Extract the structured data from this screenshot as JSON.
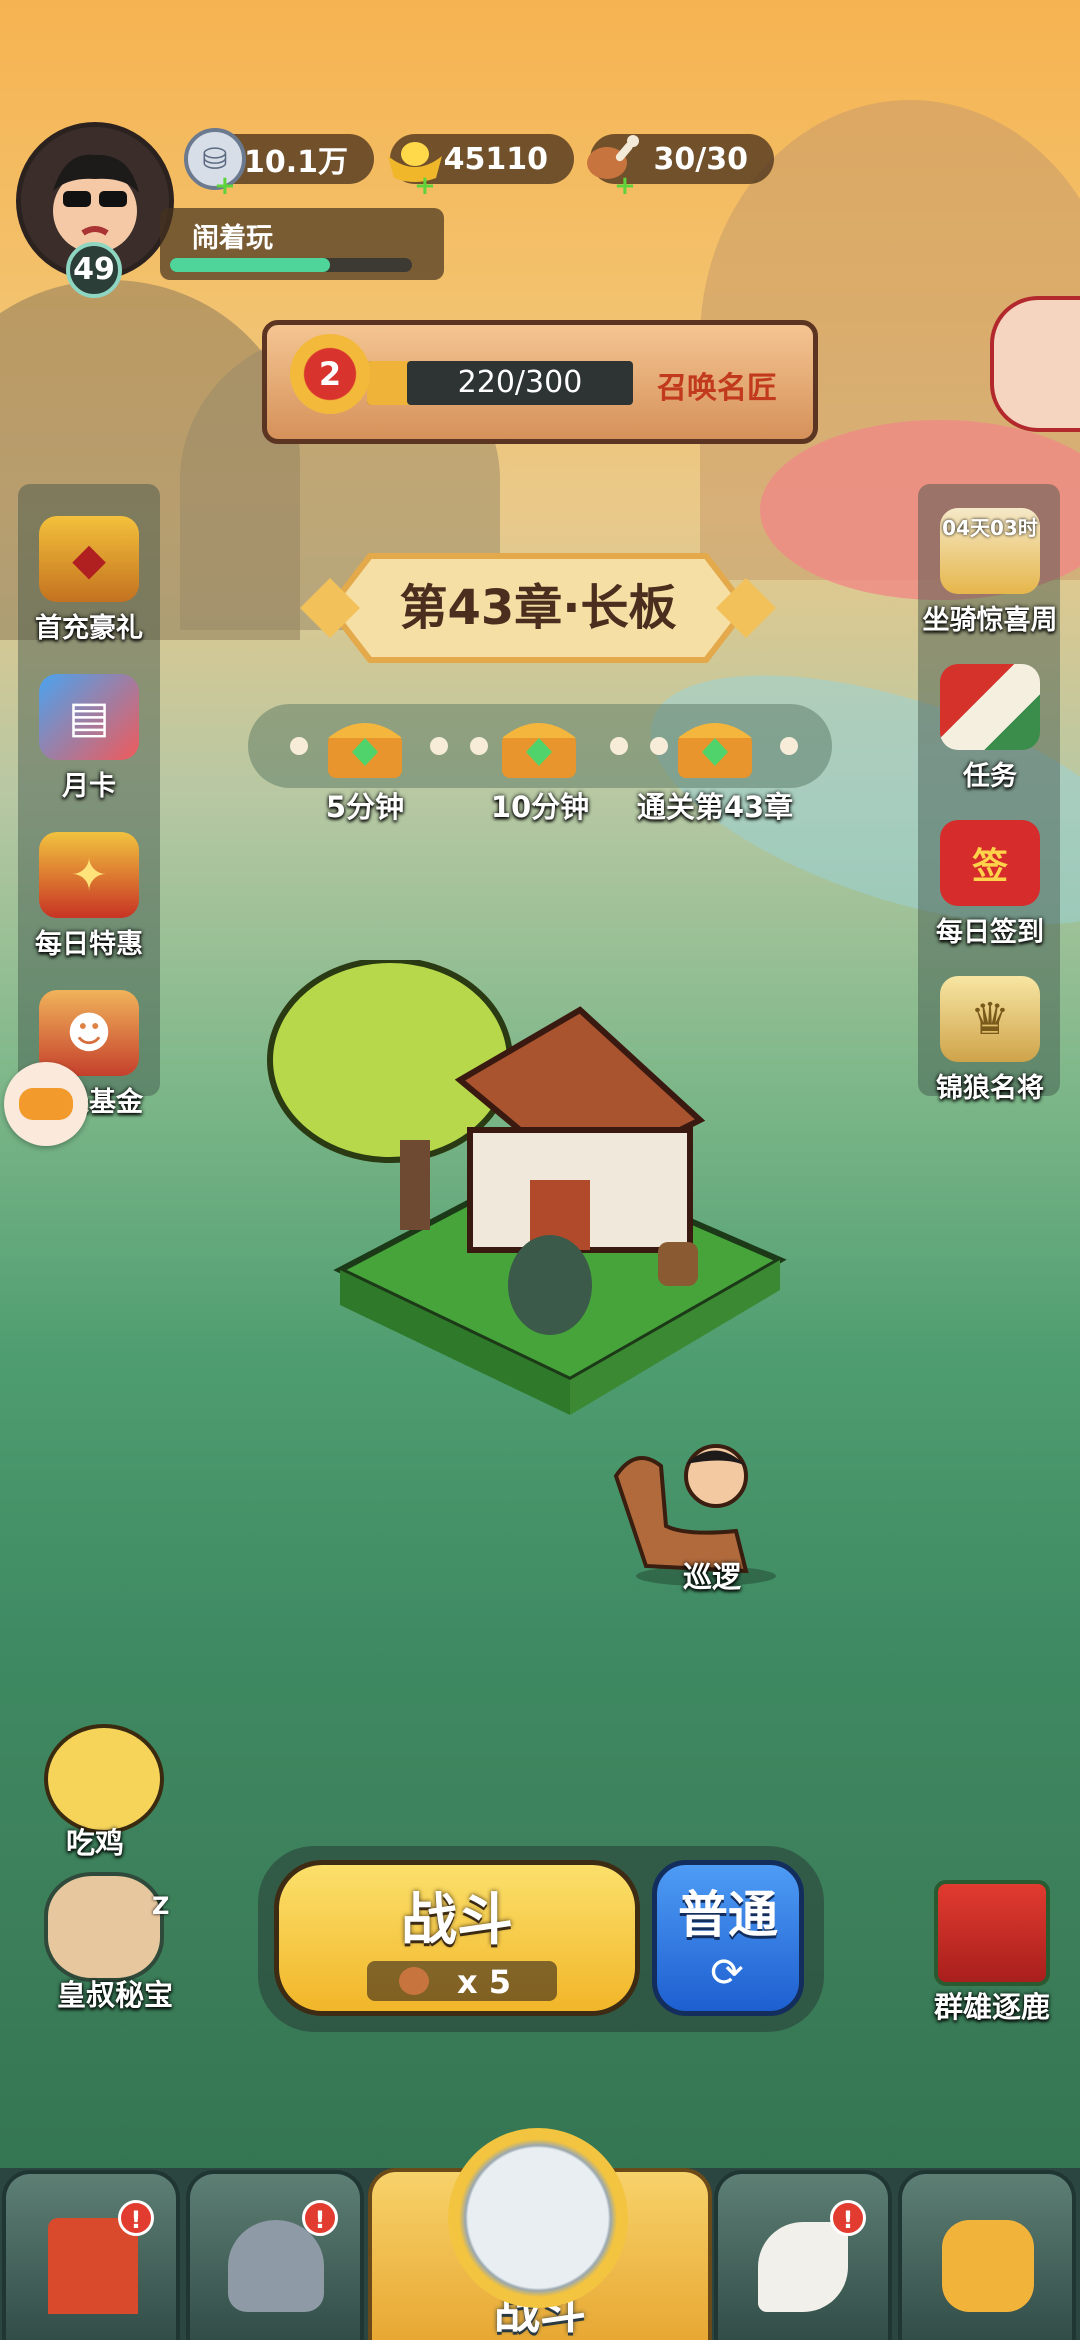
{
  "player": {
    "name": "闹着玩",
    "level": "49",
    "exp_progress": 0.66
  },
  "currencies": [
    {
      "icon": "silver-coin-icon",
      "value": "10.1万"
    },
    {
      "icon": "gold-ingot-icon",
      "value": "45110"
    },
    {
      "icon": "meat-stamina-icon",
      "value": "30/30"
    }
  ],
  "summon": {
    "rank": "2",
    "progress_text": "220/300",
    "progress": 0.733,
    "action_label": "召唤名匠"
  },
  "chapter": {
    "title": "第43章·长板"
  },
  "rewards": [
    {
      "label": "5分钟"
    },
    {
      "label": "10分钟"
    },
    {
      "label": "通关第43章"
    }
  ],
  "left_menu": [
    {
      "label": "首充豪礼",
      "icon": "treasure-chest-icon"
    },
    {
      "label": "月卡",
      "icon": "month-card-icon"
    },
    {
      "label": "每日特惠",
      "icon": "gift-bag-icon"
    },
    {
      "label": "成长基金",
      "icon": "growth-fund-icon"
    }
  ],
  "right_menu": [
    {
      "label": "坐骑惊喜周",
      "timer": "04天03时",
      "icon": "mount-event-icon"
    },
    {
      "label": "任务",
      "icon": "scroll-icon"
    },
    {
      "label": "每日签到",
      "stamp": "签",
      "icon": "sign-in-icon"
    },
    {
      "label": "锦狼名将",
      "icon": "general-helmet-icon"
    }
  ],
  "patrol": {
    "label": "巡逻"
  },
  "bottom_left": [
    {
      "label": "吃鸡",
      "icon": "chicken-icon"
    },
    {
      "label": "皇叔秘宝",
      "icon": "uncle-treasure-icon",
      "sleep": "Z"
    }
  ],
  "battle": {
    "label": "战斗",
    "cost": "x 5"
  },
  "mode": {
    "label": "普通",
    "refresh_icon": "refresh-icon"
  },
  "event_right": {
    "label": "群雄逐鹿",
    "icon": "banner-icon"
  },
  "nav": [
    {
      "label": "",
      "icon": "shop-gate-icon",
      "badge": "!"
    },
    {
      "label": "",
      "icon": "helmet-icon",
      "badge": "!"
    },
    {
      "label": "战斗",
      "icon": "crossed-swords-icon"
    },
    {
      "label": "",
      "icon": "hero-horn-icon",
      "badge": "!"
    },
    {
      "label": "",
      "icon": "fist-upgrade-icon"
    }
  ],
  "colors": {
    "gold": "#f7c53d",
    "battle_blue": "#1e6fe0",
    "exp_green": "#4fd59a"
  }
}
